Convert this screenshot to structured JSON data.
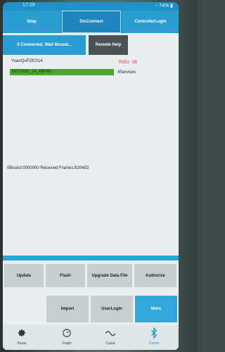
{
  "status": {
    "time": "17:29",
    "battery": "74%"
  },
  "topbar": {
    "stop": "Stop",
    "disconnect": "DisConnect",
    "controller_login": "ControllerLogin"
  },
  "connection_status": "0 Connected, Wait Bound...",
  "remote_help": "Remote Help",
  "device": {
    "name": "YuanQuFOC014",
    "rssi": "RSSI: -59",
    "id": "N072930_24_ABH90",
    "services": "4Services"
  },
  "info_line": "0Bound:0000000   Received Frames:820483",
  "buttons": {
    "update": "Update",
    "flash": "Flash",
    "upgrade_data_file": "Upgrade Data File",
    "authorize": "Authorize",
    "import": "Import",
    "user_login": "UserLogin",
    "more": "More"
  },
  "nav": [
    {
      "label": "Paras",
      "icon": "gear-icon"
    },
    {
      "label": "Graph",
      "icon": "gauge-icon"
    },
    {
      "label": "Curve",
      "icon": "wave-icon"
    },
    {
      "label": "Comm",
      "icon": "bluetooth-icon"
    }
  ],
  "colors": {
    "accent": "#1c92c9",
    "green": "#4aa72c",
    "rssi": "#e0302a"
  }
}
